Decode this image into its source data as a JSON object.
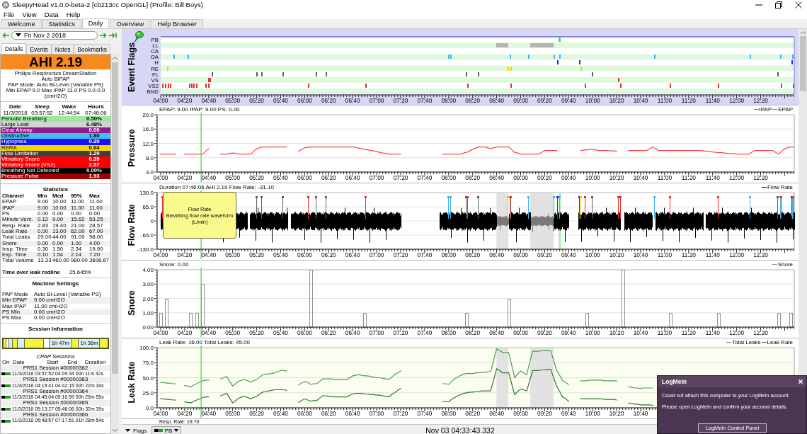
{
  "window": {
    "title": "SleepyHead v1.0.0-beta-2 [cb213cc OpenGL] (Profile: Bill Boys)"
  },
  "menu": [
    "File",
    "View",
    "Data",
    "Help"
  ],
  "tabs": [
    {
      "label": "Welcome",
      "selected": false
    },
    {
      "label": "Statistics",
      "selected": false
    },
    {
      "label": "Daily",
      "selected": true
    },
    {
      "label": "Overview",
      "selected": false
    },
    {
      "label": "Help Browser",
      "selected": false
    }
  ],
  "sidebar": {
    "date": "Fri Nov 2 2018",
    "tabs": [
      {
        "label": "Details",
        "selected": true
      },
      {
        "label": "Events",
        "selected": false
      },
      {
        "label": "Notes",
        "selected": false
      },
      {
        "label": "Bookmarks",
        "selected": false
      }
    ],
    "ahi": "AHI 2.19",
    "device_lines": [
      "Philips Respironics DreamStation",
      "Auto BiPAP",
      "PAP Mode: Auto Bi-Level (Variable PS)",
      "Min EPAP 9.0 Max IPAP 11.0 PS 0.0-0.0",
      "(cmH2O)"
    ],
    "times": {
      "columns": [
        "Date",
        "Sleep",
        "Wake",
        "Hours"
      ],
      "values": [
        "11/3/2018",
        "03:57:52",
        "12:44:54",
        "07:46:06"
      ]
    },
    "indices": [
      {
        "name": "Periodic Breathing",
        "value": "0.50%",
        "color": "#9ee89e"
      },
      {
        "name": "Large Leak",
        "value": "6.48%",
        "color": "#d4d4d4"
      },
      {
        "name": "Clear Airway",
        "value": "0.00",
        "color": "#8c1c8c"
      },
      {
        "name": "Obstructive",
        "value": "1.80",
        "color": "#44bcec"
      },
      {
        "name": "Hypopnea",
        "value": "0.39",
        "color": "#1414f4"
      },
      {
        "name": "RERA",
        "value": "0.64",
        "color": "#f8d400"
      },
      {
        "name": "Flow Limitation",
        "value": "1.29",
        "color": "#404040"
      },
      {
        "name": "Vibratory Snore",
        "value": "0.39",
        "color": "#ff0000"
      },
      {
        "name": "Vibratory Snore (VS2)",
        "value": "2.57",
        "color": "#ff0000"
      },
      {
        "name": "Breathing Not Detected",
        "value": "0.00%",
        "color": "#000000"
      },
      {
        "name": "Pressure Pulse",
        "value": "1.93",
        "color": "#a00000"
      }
    ],
    "statistics": {
      "title": "Statistics",
      "columns": [
        "Channel",
        "Min",
        "Med",
        "95%",
        "Max"
      ],
      "rows": [
        [
          "EPAP",
          "9.00",
          "10.00",
          "11.00",
          "11.00"
        ],
        [
          "IPAP",
          "9.00",
          "10.00",
          "11.00",
          "11.00"
        ],
        [
          "PS",
          "0.00",
          "0.00",
          "0.00",
          "0.00"
        ],
        [
          "Minute Vent.",
          "0.12",
          "9.00",
          "15.62",
          "53.25"
        ],
        [
          "Resp. Rate",
          "2.83",
          "19.40",
          "21.00",
          "28.57"
        ],
        [
          "Leak Rate",
          "0.00",
          "13.00",
          "62.00",
          "67.00"
        ],
        [
          "Total Leaks",
          "29.00",
          "44.00",
          "91.00",
          "98.00"
        ],
        [
          "Snore",
          "0.00",
          "0.00",
          "1.00",
          "4.00"
        ],
        [
          "Insp. Time",
          "0.30",
          "1.50",
          "2.34",
          "19.90"
        ],
        [
          "Exp. Time",
          "0.10",
          "1.54",
          "2.14",
          "7.20"
        ],
        [
          "Tidal Volume",
          "13.33",
          "460.00",
          "980.00",
          "3696.67"
        ]
      ]
    },
    "leak_redline": {
      "label": "Time over leak redline",
      "value": "25.645%"
    },
    "machine_settings": {
      "title": "Machine Settings",
      "rows": [
        [
          "PAP Mode",
          "Auto Bi-Level (Variable PS)"
        ],
        [
          "Min EPAP",
          "9.00 cmH2O"
        ],
        [
          "Max IPAP",
          "11.00 cmH2O"
        ],
        [
          "PS Min",
          "0.00 cmH2O"
        ],
        [
          "PS Max",
          "0.00 cmH2O"
        ]
      ]
    },
    "session_info": {
      "title": "Session Information",
      "bar_labels": [
        "1h 47m",
        "1h 36m"
      ]
    },
    "cpap_sessions": {
      "title": "CPAP Sessions",
      "columns": [
        "On",
        "Date",
        "Start",
        "End",
        "Duration"
      ],
      "rows": [
        {
          "name": "PRS1 Session #00000362",
          "on": true,
          "date": "11/3/2018",
          "start": "03:57:52",
          "end": "04:09:34",
          "duration": "00h 11m 42s"
        },
        {
          "name": "PRS1 Session #00000363",
          "on": true,
          "date": "11/3/2018",
          "start": "04:19:41",
          "end": "04:42:15",
          "duration": "00h 22m 34s"
        },
        {
          "name": "PRS1 Session #00000364",
          "on": true,
          "date": "11/3/2018",
          "start": "04:45:04",
          "end": "05:10:59",
          "duration": "00h 25m 55s"
        },
        {
          "name": "PRS1 Session #00000365",
          "on": true,
          "date": "11/3/2018",
          "start": "05:13:27",
          "end": "05:46:06",
          "duration": "00h 32m 39s"
        },
        {
          "name": "PRS1 Session #00000366",
          "on": true,
          "date": "11/3/2018",
          "start": "05:48:57",
          "end": "07:17:51",
          "duration": "01h 28m 54s"
        }
      ]
    }
  },
  "event_flags": {
    "title": "Event Flags",
    "rows": [
      {
        "label": "PB",
        "color": "#5cd05c"
      },
      {
        "label": "LL",
        "color": "#b4b4b4"
      },
      {
        "label": "CA"
      },
      {
        "label": "OA",
        "color": "#40b4f0"
      },
      {
        "label": "H",
        "color": "#2828f0"
      },
      {
        "label": "RE",
        "color": "#f0d000"
      },
      {
        "label": "FL",
        "color": "#606060"
      },
      {
        "label": "VS",
        "color": "#e83030"
      },
      {
        "label": "VS2",
        "color": "#e83030"
      },
      {
        "label": "BND"
      }
    ],
    "x_labels": [
      "04:00",
      "04:20",
      "04:40",
      "05:00",
      "05:20",
      "05:40",
      "06:00",
      "06:20",
      "06:40",
      "07:00",
      "07:20",
      "07:40",
      "08:00",
      "08:20",
      "08:40",
      "09:00",
      "09:20",
      "09:40",
      "10:00",
      "10:20",
      "10:40",
      "11:00",
      "11:20",
      "11:40",
      "12:00",
      "12:20"
    ]
  },
  "pressure": {
    "readout": "EPAP: 9.00 IPAP: 9.00 PS: 0.00",
    "legend_extra": [
      {
        "name": "EPAP",
        "color": "#30c030"
      }
    ],
    "chart_data": {
      "type": "line",
      "ylabel": "Pressure",
      "grid": true,
      "categories": [
        "04:00",
        null,
        null,
        null,
        null,
        null,
        null,
        null,
        "04:20",
        null,
        null,
        null,
        null,
        null,
        null,
        null,
        "04:40",
        null,
        null,
        null,
        null,
        null,
        null,
        null,
        "05:00",
        null,
        null,
        null,
        null,
        null,
        null,
        null,
        "05:20",
        null,
        null,
        null,
        null,
        null,
        null,
        null,
        "05:40",
        null,
        null,
        null,
        null,
        null,
        null,
        null,
        "06:00",
        null,
        null,
        null,
        null,
        null,
        null,
        null,
        "06:20",
        null,
        null,
        null,
        null,
        null,
        null,
        null,
        "06:40",
        null,
        null,
        null,
        null,
        null,
        null,
        null,
        "07:00",
        null,
        null,
        null,
        null,
        null,
        null,
        null,
        "07:20",
        null,
        null,
        null,
        null,
        null,
        null,
        null,
        "07:40",
        null,
        null,
        null,
        null,
        null,
        null,
        null,
        "08:00",
        null,
        null,
        null,
        null,
        null,
        null,
        null,
        "08:20",
        null,
        null,
        null,
        null,
        null,
        null,
        null,
        "08:40",
        null,
        null,
        null,
        null,
        null,
        null,
        null,
        "09:00",
        null,
        null,
        null,
        null,
        null,
        null,
        null,
        "09:20",
        null,
        null,
        null,
        null,
        null,
        null,
        null,
        "09:40",
        null,
        null,
        null,
        null,
        null,
        null,
        null,
        "10:00",
        null,
        null,
        null,
        null,
        null,
        null,
        null,
        "10:20",
        null,
        null,
        null,
        null,
        null,
        null,
        null,
        "10:40",
        null,
        null,
        null,
        null,
        null,
        null,
        null,
        "11:00",
        null,
        null,
        null,
        null,
        null,
        null,
        null,
        "11:20",
        null,
        null,
        null,
        null,
        null,
        null,
        null,
        "11:40",
        null,
        null,
        null,
        null,
        null,
        null,
        null,
        "12:00",
        null,
        null,
        null,
        null,
        null,
        null,
        null,
        "12:20",
        null,
        null,
        null,
        null,
        null,
        null,
        null,
        null,
        null,
        null,
        null
      ],
      "series": [
        {
          "name": "IPAP",
          "color": "#ff4040",
          "values": [
            9,
            9,
            9,
            9,
            9,
            9,
            null,
            null,
            9,
            9,
            9,
            9,
            9,
            9,
            9,
            9.8,
            10.5,
            null,
            null,
            null,
            9,
            9,
            9,
            9.2,
            9.3,
            9.2,
            9,
            9,
            9,
            9,
            9,
            9.8,
            10.5,
            10.8,
            11,
            11,
            11,
            11,
            11,
            11,
            11,
            11,
            11,
            null,
            null,
            null,
            9.8,
            10.3,
            10.8,
            10.9,
            11,
            11,
            11,
            11,
            11,
            11,
            11,
            11,
            11,
            11,
            11,
            11,
            11,
            11,
            11,
            10.9,
            10.7,
            10.5,
            10.3,
            10.2,
            10,
            9.9,
            9.7,
            9.5,
            9.3,
            9.2,
            9,
            9,
            9,
            9,
            9,
            null,
            null,
            null,
            null,
            null,
            null,
            null,
            null,
            null,
            null,
            null,
            null,
            null,
            9,
            9,
            9,
            9,
            9,
            9,
            9,
            9.3,
            9.5,
            9.9,
            10.3,
            10.7,
            11,
            11,
            11,
            10.8,
            10.5,
            10.8,
            11,
            11,
            11,
            11,
            11,
            10.3,
            9.5,
            9.3,
            9,
            9,
            9,
            9,
            9,
            9,
            9,
            9.5,
            10,
            10,
            10,
            10,
            10,
            null,
            null,
            null,
            null,
            null,
            null,
            null,
            10,
            10.1,
            10.2,
            10.3,
            10.4,
            10.2,
            10,
            10,
            10,
            10,
            9.9,
            9.9,
            9.8,
            null,
            null,
            null,
            10,
            10,
            10,
            10,
            10,
            10,
            10,
            10.5,
            11,
            10.5,
            10,
            10,
            10,
            10,
            10,
            10,
            10,
            10,
            10,
            10,
            10,
            10,
            10,
            10,
            10,
            9.9,
            9.8,
            9.7,
            9.6,
            9.5,
            9.4,
            9.4,
            9.3,
            9.2,
            9.1,
            9.1,
            9,
            9,
            9,
            9,
            9,
            9.5,
            10,
            10,
            10,
            10,
            10,
            10,
            10,
            9.5,
            9,
            9.8,
            10.5,
            10.8,
            11,
            11
          ]
        }
      ],
      "ylim": [
        4,
        20
      ],
      "yticks": [
        {
          "value": 4,
          "label": "4.0"
        },
        {
          "value": 8,
          "label": "8.0"
        },
        {
          "value": 12,
          "label": "12.0"
        },
        {
          "value": 16,
          "label": "16.0"
        },
        {
          "value": 20,
          "label": "20.0"
        }
      ]
    }
  },
  "flow_rate": {
    "title": "Flow Rate",
    "readout": "Duration 07:46:06 AHI 2.19 Flow Rate: -31.10",
    "legend": [
      {
        "name": "Flow Rate",
        "color": "#000000"
      }
    ],
    "y_labels": [
      "130.0",
      "65.0",
      "0",
      "-65.0",
      "-130.0"
    ],
    "x_labels": [
      "04:00",
      "04:20",
      "04:40",
      "05:00",
      "05:20",
      "05:40",
      "06:00",
      "06:20",
      "06:40",
      "07:00",
      "07:20",
      "07:40",
      "08:00",
      "08:20",
      "08:40",
      "09:00",
      "09:20",
      "09:40",
      "10:00",
      "10:20",
      "10:40",
      "11:00",
      "11:20",
      "11:40",
      "12:00",
      "12:20"
    ],
    "tooltip": {
      "title": "Flow Rate",
      "lines": [
        "Breathing flow rate waveform",
        "(L/min)"
      ]
    }
  },
  "snore": {
    "readout": "Snore: 0.00",
    "chart_data": {
      "type": "bar",
      "ylabel": "Snore",
      "grid": true,
      "categories": [
        "04:00",
        null,
        null,
        null,
        "04:20",
        null,
        null,
        null,
        "04:40",
        null,
        null,
        null,
        "05:00",
        null,
        null,
        null,
        "05:20",
        null,
        null,
        null,
        "05:40",
        null,
        null,
        null,
        "06:00",
        null,
        null,
        null,
        "06:20",
        null,
        null,
        null,
        "06:40",
        null,
        null,
        null,
        "07:00",
        null,
        null,
        null,
        "07:20",
        null,
        null,
        null,
        "07:40",
        null,
        null,
        null,
        "08:00",
        null,
        null,
        null,
        "08:20",
        null,
        null,
        null,
        "08:40",
        null,
        null,
        null,
        "09:00",
        null,
        null,
        null,
        "09:20",
        null,
        null,
        null,
        "09:40",
        null,
        null,
        null,
        "10:00",
        null,
        null,
        null,
        "10:20",
        null,
        null,
        null,
        "10:40",
        null,
        null,
        null,
        "11:00",
        null,
        null,
        null,
        "11:20",
        null,
        null,
        null,
        "11:40",
        null,
        null,
        null,
        "12:00",
        null,
        null,
        null,
        "12:20",
        null,
        null,
        null,
        null,
        null
      ],
      "series": [
        {
          "name": "Snore",
          "color": "#909090",
          "values": [
            1,
            2,
            0,
            0,
            0,
            1,
            1,
            3,
            0,
            0,
            0,
            0,
            0,
            0,
            0,
            0,
            0,
            0,
            0,
            0,
            0,
            0,
            0,
            0,
            0,
            4,
            0,
            0,
            0,
            0,
            0,
            0,
            0,
            0,
            1,
            0,
            0,
            0,
            0,
            0,
            0,
            0,
            0,
            0,
            0,
            0,
            0,
            0,
            0,
            0,
            0,
            1,
            0,
            0,
            0,
            0,
            0,
            0,
            2,
            0,
            0,
            0,
            0,
            0,
            0,
            0,
            0,
            0,
            0,
            0,
            0,
            1,
            0,
            0,
            0,
            0,
            0,
            4,
            0,
            0,
            0,
            0,
            0,
            0,
            0,
            1,
            0,
            0,
            0,
            0,
            0,
            0,
            0,
            1,
            0,
            0,
            0,
            0,
            0,
            0,
            0,
            0,
            0,
            1,
            0,
            1
          ]
        }
      ],
      "ylim": [
        0,
        4
      ],
      "yticks": [
        {
          "value": 0,
          "label": "0.00"
        },
        {
          "value": 1,
          "label": "1.00"
        },
        {
          "value": 2,
          "label": "2.00"
        },
        {
          "value": 3,
          "label": "3.00"
        },
        {
          "value": 4,
          "label": "4.00"
        }
      ]
    }
  },
  "leak_rate": {
    "readout": "Leak Rate: 16.00 Total Leaks: 45.00",
    "chart_data": {
      "type": "line",
      "ylabel": "Leak Rate",
      "grid": true,
      "categories": [
        "04:00",
        null,
        null,
        null,
        null,
        null,
        null,
        null,
        "04:20",
        null,
        null,
        null,
        null,
        null,
        null,
        null,
        "04:40",
        null,
        null,
        null,
        null,
        null,
        null,
        null,
        "05:00",
        null,
        null,
        null,
        null,
        null,
        null,
        null,
        "05:20",
        null,
        null,
        null,
        null,
        null,
        null,
        null,
        "05:40",
        null,
        null,
        null,
        null,
        null,
        null,
        null,
        "06:00",
        null,
        null,
        null,
        null,
        null,
        null,
        null,
        "06:20",
        null,
        null,
        null,
        null,
        null,
        null,
        null,
        "06:40",
        null,
        null,
        null,
        null,
        null,
        null,
        null,
        "07:00",
        null,
        null,
        null,
        null,
        null,
        null,
        null,
        "07:20",
        null,
        null,
        null,
        null,
        null,
        null,
        null,
        "07:40",
        null,
        null,
        null,
        null,
        null,
        null,
        null,
        "08:00",
        null,
        null,
        null,
        null,
        null,
        null,
        null,
        "08:20",
        null,
        null,
        null,
        null,
        null,
        null,
        null,
        "08:40",
        null,
        null,
        null,
        null,
        null,
        null,
        null,
        "09:00",
        null,
        null,
        null,
        null,
        null,
        null,
        null,
        "09:20",
        null,
        null,
        null,
        null,
        null,
        null,
        null,
        "09:40",
        null,
        null,
        null,
        null,
        null,
        null,
        null,
        "10:00",
        null,
        null,
        null,
        null,
        null,
        null,
        null,
        "10:20",
        null,
        null,
        null,
        null,
        null,
        null,
        null,
        "10:40",
        null,
        null,
        null,
        null,
        null,
        null,
        null,
        null,
        null,
        null,
        null,
        null,
        null,
        null,
        null,
        null,
        null,
        null,
        null,
        null,
        null,
        null,
        null,
        null,
        null,
        null,
        null,
        null,
        null,
        null,
        null,
        null,
        null,
        null,
        null,
        null,
        null,
        null,
        null,
        null,
        null,
        null,
        null,
        null,
        null,
        null,
        null,
        null,
        null,
        null,
        null
      ],
      "series": [
        {
          "name": "Total Leaks",
          "color": "#4f9f4f",
          "values": [
            42,
            42,
            41,
            41,
            40,
            40,
            null,
            null,
            37,
            36,
            35,
            38,
            40,
            43,
            45,
            46,
            46,
            null,
            null,
            null,
            48,
            50,
            52,
            44,
            36,
            40,
            44,
            46,
            47,
            45,
            43,
            45,
            47,
            51,
            55,
            56,
            56,
            57,
            58,
            60,
            62,
            62,
            61,
            null,
            null,
            null,
            38,
            41,
            44,
            42,
            39,
            40,
            40,
            44,
            48,
            48,
            48,
            48,
            47,
            47,
            47,
            47,
            47,
            50,
            53,
            54,
            55,
            54,
            53,
            53,
            52,
            51,
            50,
            50,
            49,
            48,
            47,
            51,
            55,
            58,
            61,
            null,
            null,
            null,
            null,
            null,
            null,
            null,
            null,
            null,
            null,
            null,
            null,
            null,
            40,
            40,
            39,
            44,
            48,
            51,
            54,
            56,
            57,
            57,
            57,
            58,
            58,
            59,
            59,
            60,
            60,
            79,
            98,
            95,
            92,
            92,
            92,
            71,
            50,
            56,
            61,
            58,
            55,
            75,
            94,
            94,
            94,
            95,
            95,
            95,
            95,
            79,
            62,
            54,
            45,
            42,
            39,
            null,
            null,
            null,
            45,
            45,
            45,
            46,
            46,
            46,
            46,
            46,
            45,
            45,
            45,
            45,
            45,
            null,
            null,
            null,
            35,
            34,
            33,
            33,
            32,
            33,
            33,
            33,
            33,
            null,
            null,
            null,
            null,
            null,
            null,
            null,
            null,
            null,
            null,
            null,
            null,
            null,
            null,
            null,
            null,
            null,
            null,
            null,
            null,
            null,
            null,
            null,
            null,
            null,
            null,
            null,
            null,
            null,
            null,
            null,
            null,
            null,
            null,
            null,
            null,
            null,
            null,
            null,
            null,
            null,
            null,
            null,
            null,
            null,
            null,
            null
          ]
        },
        {
          "name": "Leak Rate",
          "color": "#2a7a2a",
          "values": [
            15,
            15,
            14,
            14,
            13,
            13,
            null,
            null,
            10,
            9,
            8,
            11,
            13,
            15,
            17,
            18,
            18,
            null,
            null,
            null,
            20,
            22,
            24,
            16,
            8,
            12,
            16,
            18,
            19,
            17,
            15,
            17,
            19,
            23,
            26,
            27,
            28,
            29,
            30,
            30,
            30,
            30,
            29,
            null,
            null,
            null,
            9,
            12,
            15,
            13,
            11,
            12,
            12,
            16,
            20,
            20,
            19,
            19,
            18,
            18,
            18,
            18,
            18,
            21,
            23,
            24,
            24,
            24,
            23,
            23,
            22,
            22,
            21,
            21,
            20,
            19,
            18,
            22,
            25,
            29,
            32,
            null,
            null,
            null,
            null,
            null,
            null,
            null,
            null,
            null,
            null,
            null,
            null,
            null,
            10,
            10,
            10,
            14,
            17,
            20,
            22,
            24,
            25,
            26,
            26,
            27,
            27,
            28,
            28,
            28,
            28,
            47,
            65,
            62,
            58,
            58,
            58,
            40,
            22,
            27,
            31,
            30,
            28,
            45,
            62,
            62,
            62,
            63,
            63,
            64,
            64,
            50,
            36,
            27,
            18,
            15,
            11,
            null,
            null,
            null,
            15,
            15,
            15,
            15,
            15,
            15,
            15,
            15,
            14,
            14,
            14,
            14,
            13,
            null,
            null,
            null,
            8,
            7,
            6,
            6,
            5,
            5,
            5,
            5,
            4,
            null,
            null,
            null,
            null,
            null,
            null,
            null,
            null,
            null,
            null,
            null,
            null,
            null,
            null,
            null,
            null,
            null,
            null,
            null,
            null,
            null,
            null,
            null,
            null,
            null,
            null,
            null,
            null,
            null,
            null,
            null,
            null,
            null,
            null,
            null,
            null,
            null,
            null,
            null,
            null,
            null,
            null,
            null,
            null,
            null,
            null,
            null
          ]
        }
      ],
      "ylim": [
        0,
        100
      ],
      "yticks": [
        {
          "value": 0,
          "label": "0.0"
        },
        {
          "value": 25,
          "label": "25.0"
        },
        {
          "value": 50,
          "label": "50.0"
        },
        {
          "value": 75,
          "label": "75.0"
        },
        {
          "value": 100,
          "label": "100.0"
        }
      ]
    }
  },
  "next_panel": {
    "readout": "Resp. Rate: 19.70"
  },
  "bottom_bar": {
    "flags_button": "Flags",
    "flag_select": "PB",
    "time": "Nov 03 04:33:43.332"
  },
  "popup": {
    "title": "LogMeIn",
    "messages": [
      "Could not attach this computer to your LogMeIn account.",
      "Please open LogMeIn and confirm your account details."
    ],
    "button": "LogMeIn Control Panel"
  }
}
